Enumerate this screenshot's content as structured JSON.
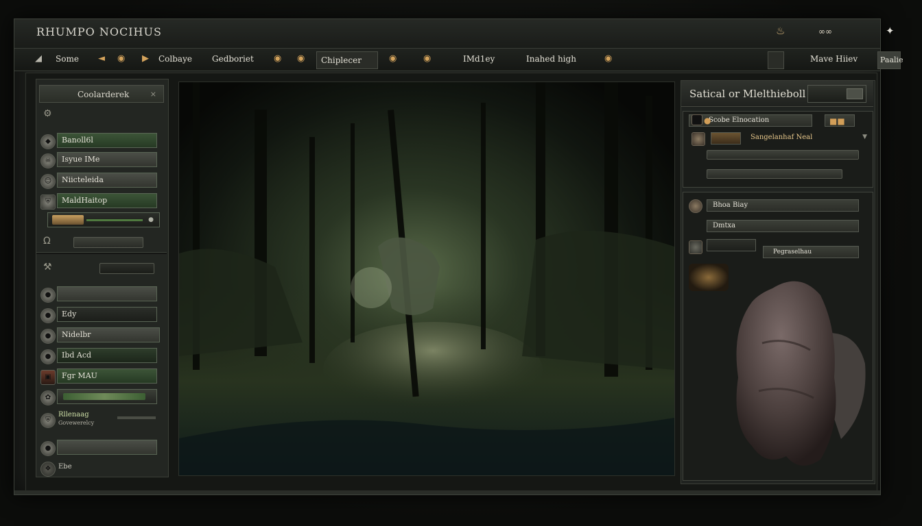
{
  "window": {
    "title": "RHUMPO NOCIHUS",
    "icons": [
      "pot-icon",
      "goggles-icon",
      "dragon-icon"
    ]
  },
  "menubar": {
    "items": [
      {
        "label": "Some"
      },
      {
        "label": "Colbaye"
      },
      {
        "label": "Gedboriet"
      },
      {
        "label": "Chiplecer"
      },
      {
        "label": "IMd1ey"
      },
      {
        "label": "Inahed high"
      },
      {
        "label": "Mave Hiiev"
      },
      {
        "label": "Paalie"
      }
    ]
  },
  "left_panel": {
    "header": "Coolarderek",
    "close_glyph": "×",
    "group1": [
      {
        "label": "Banoll6l",
        "icon": "gem-icon"
      },
      {
        "label": "Isyue IMe",
        "icon": "skull-icon"
      },
      {
        "label": "Niicteleida",
        "icon": "face-icon"
      },
      {
        "label": "MaldHaitop",
        "icon": "shield-icon"
      },
      {
        "label": "",
        "icon": "coin-icon"
      },
      {
        "label": "",
        "icon": "ring-icon"
      }
    ],
    "group2": [
      {
        "label": "",
        "icon": "orb-icon"
      },
      {
        "label": "Edy",
        "icon": "orb-icon"
      },
      {
        "label": "Nidelbr",
        "icon": "orb-icon"
      },
      {
        "label": "Ibd Acd",
        "icon": "orb-icon"
      },
      {
        "label": "Fgr MAU",
        "icon": "book-icon"
      },
      {
        "label": "",
        "icon": "claw-icon"
      },
      {
        "label": "Rllenaag",
        "sublabel": "Govewerelcy",
        "icon": "shield-icon"
      },
      {
        "label": "",
        "icon": "orb-icon"
      }
    ],
    "footer": "Ebe"
  },
  "right_panel": {
    "title": "Satical or Mlelthieboll",
    "section1": {
      "header": "Scobe Elnocation",
      "row_accent": "Sangelanhaf Neal"
    },
    "section2": {
      "row1": "Bhoa Biay",
      "row2": "Dmtxa",
      "row3": "Pegraselhau"
    }
  },
  "colors": {
    "accent": "#d29e58",
    "bar_green": "#3c5437",
    "panel_bg": "#232622"
  }
}
